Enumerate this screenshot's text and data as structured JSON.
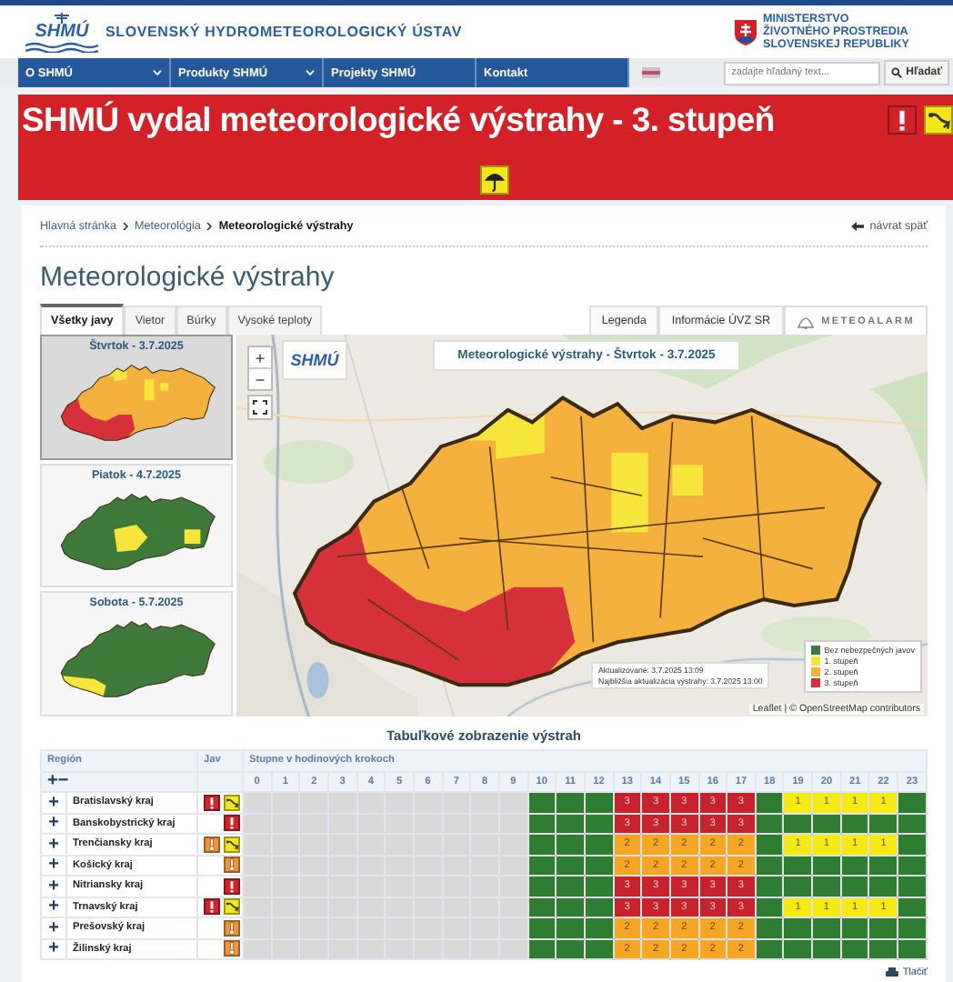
{
  "header": {
    "logo": "SHMÚ",
    "institute": "SLOVENSKÝ HYDROMETEOROLOGICKÝ ÚSTAV",
    "ministry": [
      "MINISTERSTVO",
      "ŽIVOTNÉHO PROSTREDIA",
      "SLOVENSKEJ REPUBLIKY"
    ]
  },
  "nav": {
    "items": [
      {
        "label": "O SHMÚ",
        "dropdown": true
      },
      {
        "label": "Produkty SHMÚ",
        "dropdown": true
      },
      {
        "label": "Projekty SHMÚ",
        "dropdown": false
      },
      {
        "label": "Kontakt",
        "dropdown": false
      }
    ],
    "search": {
      "placeholder": "zadajte hľadaný text..."
    },
    "search_button": "Hľadať"
  },
  "banner": {
    "title": "SHMÚ vydal meteorologické výstrahy - 3. stupeň",
    "icons": [
      {
        "kind": "exclamation",
        "color": "#d3232a"
      },
      {
        "kind": "wind",
        "color": "#f5e61a"
      }
    ],
    "second_row_icons": [
      {
        "kind": "umbrella",
        "color": "#f5e61a"
      }
    ]
  },
  "breadcrumb": [
    "Hlavná stránka",
    "Meteorológia",
    "Meteorologické výstrahy"
  ],
  "back_link": "návrat späť",
  "page_title": "Meteorologické výstrahy",
  "tabs": [
    {
      "label": "Všetky javy",
      "selected": true
    },
    {
      "label": "Vietor",
      "selected": false
    },
    {
      "label": "Búrky",
      "selected": false
    },
    {
      "label": "Vysoké teploty",
      "selected": false
    }
  ],
  "buttons": [
    "Legenda",
    "Informácie ÚVZ SR"
  ],
  "meteoalarm": "METEOALARM",
  "days": [
    {
      "label": "Štvrtok - 3.7.2025",
      "selected": true
    },
    {
      "label": "Piatok - 4.7.2025",
      "selected": false
    },
    {
      "label": "Sobota - 5.7.2025",
      "selected": false
    }
  ],
  "map": {
    "zoom_in": "+",
    "zoom_out": "−",
    "logo": "SHMÚ",
    "title": "Meteorologické výstrahy - Štvrtok - 3.7.2025",
    "legend": [
      {
        "label": "Bez nebezpečných javov",
        "color": "#3e7b3a"
      },
      {
        "label": "1. stupeň",
        "color": "#f6e53a"
      },
      {
        "label": "2. stupeň",
        "color": "#f4b13e"
      },
      {
        "label": "3. stupeň",
        "color": "#d6303a"
      }
    ],
    "updated": "Aktualizované: 3.7.2025 13:09",
    "next_update": "Najbližšia aktualizácia výstrahy: 3.7.2025 13:00",
    "attribution": "Leaflet | © OpenStreetMap contributors"
  },
  "table": {
    "title": "Tabuľkové zobrazenie výstrah",
    "region_header": "Región",
    "phenomenon_header": "Jav",
    "hours_header": "Stupne v hodinových krokoch",
    "expand_all": "+",
    "collapse_all": "−",
    "hours": [
      "0",
      "1",
      "2",
      "3",
      "4",
      "5",
      "6",
      "7",
      "8",
      "9",
      "10",
      "11",
      "12",
      "13",
      "14",
      "15",
      "16",
      "17",
      "18",
      "19",
      "20",
      "21",
      "22",
      "23"
    ],
    "rows": [
      {
        "toggle": "+",
        "region": "Bratislavský kraj",
        "phenomena": [
          {
            "kind": "exclamation",
            "color": "#d3232a"
          },
          {
            "kind": "wind",
            "color": "#f5e61a"
          }
        ],
        "cells": [
          {
            "kind": "none"
          },
          {
            "kind": "none"
          },
          {
            "kind": "none"
          },
          {
            "kind": "none"
          },
          {
            "kind": "none"
          },
          {
            "kind": "none"
          },
          {
            "kind": "none"
          },
          {
            "kind": "none"
          },
          {
            "kind": "none"
          },
          {
            "kind": "none"
          },
          {
            "kind": "clear"
          },
          {
            "kind": "clear"
          },
          {
            "kind": "clear"
          },
          {
            "kind": "warning",
            "grade": "3"
          },
          {
            "kind": "warning",
            "grade": "3"
          },
          {
            "kind": "warning",
            "grade": "3"
          },
          {
            "kind": "warning",
            "grade": "3"
          },
          {
            "kind": "warning",
            "grade": "3"
          },
          {
            "kind": "clear"
          },
          {
            "kind": "warning",
            "grade": "1"
          },
          {
            "kind": "warning",
            "grade": "1"
          },
          {
            "kind": "warning",
            "grade": "1"
          },
          {
            "kind": "warning",
            "grade": "1"
          },
          {
            "kind": "clear"
          }
        ]
      },
      {
        "toggle": "+",
        "region": "Banskobystrický kraj",
        "phenomena": [
          {
            "kind": "exclamation",
            "color": "#d3232a"
          }
        ],
        "cells": [
          {
            "kind": "none"
          },
          {
            "kind": "none"
          },
          {
            "kind": "none"
          },
          {
            "kind": "none"
          },
          {
            "kind": "none"
          },
          {
            "kind": "none"
          },
          {
            "kind": "none"
          },
          {
            "kind": "none"
          },
          {
            "kind": "none"
          },
          {
            "kind": "none"
          },
          {
            "kind": "clear"
          },
          {
            "kind": "clear"
          },
          {
            "kind": "clear"
          },
          {
            "kind": "warning",
            "grade": "3"
          },
          {
            "kind": "warning",
            "grade": "3"
          },
          {
            "kind": "warning",
            "grade": "3"
          },
          {
            "kind": "warning",
            "grade": "3"
          },
          {
            "kind": "warning",
            "grade": "3"
          },
          {
            "kind": "clear"
          },
          {
            "kind": "clear"
          },
          {
            "kind": "clear"
          },
          {
            "kind": "clear"
          },
          {
            "kind": "clear"
          },
          {
            "kind": "clear"
          }
        ]
      },
      {
        "toggle": "+",
        "region": "Trenčiansky kraj",
        "phenomena": [
          {
            "kind": "thermometer",
            "color": "#f0943a"
          },
          {
            "kind": "wind",
            "color": "#f5e61a"
          }
        ],
        "cells": [
          {
            "kind": "none"
          },
          {
            "kind": "none"
          },
          {
            "kind": "none"
          },
          {
            "kind": "none"
          },
          {
            "kind": "none"
          },
          {
            "kind": "none"
          },
          {
            "kind": "none"
          },
          {
            "kind": "none"
          },
          {
            "kind": "none"
          },
          {
            "kind": "none"
          },
          {
            "kind": "clear"
          },
          {
            "kind": "clear"
          },
          {
            "kind": "clear"
          },
          {
            "kind": "warning",
            "grade": "2"
          },
          {
            "kind": "warning",
            "grade": "2"
          },
          {
            "kind": "warning",
            "grade": "2"
          },
          {
            "kind": "warning",
            "grade": "2"
          },
          {
            "kind": "warning",
            "grade": "2"
          },
          {
            "kind": "clear"
          },
          {
            "kind": "warning",
            "grade": "1"
          },
          {
            "kind": "warning",
            "grade": "1"
          },
          {
            "kind": "warning",
            "grade": "1"
          },
          {
            "kind": "warning",
            "grade": "1"
          },
          {
            "kind": "clear"
          }
        ]
      },
      {
        "toggle": "+",
        "region": "Košický kraj",
        "phenomena": [
          {
            "kind": "thermometer",
            "color": "#f0943a"
          }
        ],
        "cells": [
          {
            "kind": "none"
          },
          {
            "kind": "none"
          },
          {
            "kind": "none"
          },
          {
            "kind": "none"
          },
          {
            "kind": "none"
          },
          {
            "kind": "none"
          },
          {
            "kind": "none"
          },
          {
            "kind": "none"
          },
          {
            "kind": "none"
          },
          {
            "kind": "none"
          },
          {
            "kind": "clear"
          },
          {
            "kind": "clear"
          },
          {
            "kind": "clear"
          },
          {
            "kind": "warning",
            "grade": "2"
          },
          {
            "kind": "warning",
            "grade": "2"
          },
          {
            "kind": "warning",
            "grade": "2"
          },
          {
            "kind": "warning",
            "grade": "2"
          },
          {
            "kind": "warning",
            "grade": "2"
          },
          {
            "kind": "clear"
          },
          {
            "kind": "clear"
          },
          {
            "kind": "clear"
          },
          {
            "kind": "clear"
          },
          {
            "kind": "clear"
          },
          {
            "kind": "clear"
          }
        ]
      },
      {
        "toggle": "+",
        "region": "Nitriansky kraj",
        "phenomena": [
          {
            "kind": "exclamation",
            "color": "#d3232a"
          }
        ],
        "cells": [
          {
            "kind": "none"
          },
          {
            "kind": "none"
          },
          {
            "kind": "none"
          },
          {
            "kind": "none"
          },
          {
            "kind": "none"
          },
          {
            "kind": "none"
          },
          {
            "kind": "none"
          },
          {
            "kind": "none"
          },
          {
            "kind": "none"
          },
          {
            "kind": "none"
          },
          {
            "kind": "clear"
          },
          {
            "kind": "clear"
          },
          {
            "kind": "clear"
          },
          {
            "kind": "warning",
            "grade": "3"
          },
          {
            "kind": "warning",
            "grade": "3"
          },
          {
            "kind": "warning",
            "grade": "3"
          },
          {
            "kind": "warning",
            "grade": "3"
          },
          {
            "kind": "warning",
            "grade": "3"
          },
          {
            "kind": "clear"
          },
          {
            "kind": "clear"
          },
          {
            "kind": "clear"
          },
          {
            "kind": "clear"
          },
          {
            "kind": "clear"
          },
          {
            "kind": "clear"
          }
        ]
      },
      {
        "toggle": "+",
        "region": "Trnavský kraj",
        "phenomena": [
          {
            "kind": "exclamation",
            "color": "#d3232a"
          },
          {
            "kind": "wind",
            "color": "#f5e61a"
          }
        ],
        "cells": [
          {
            "kind": "none"
          },
          {
            "kind": "none"
          },
          {
            "kind": "none"
          },
          {
            "kind": "none"
          },
          {
            "kind": "none"
          },
          {
            "kind": "none"
          },
          {
            "kind": "none"
          },
          {
            "kind": "none"
          },
          {
            "kind": "none"
          },
          {
            "kind": "none"
          },
          {
            "kind": "clear"
          },
          {
            "kind": "clear"
          },
          {
            "kind": "clear"
          },
          {
            "kind": "warning",
            "grade": "3"
          },
          {
            "kind": "warning",
            "grade": "3"
          },
          {
            "kind": "warning",
            "grade": "3"
          },
          {
            "kind": "warning",
            "grade": "3"
          },
          {
            "kind": "warning",
            "grade": "3"
          },
          {
            "kind": "clear"
          },
          {
            "kind": "warning",
            "grade": "1"
          },
          {
            "kind": "warning",
            "grade": "1"
          },
          {
            "kind": "warning",
            "grade": "1"
          },
          {
            "kind": "warning",
            "grade": "1"
          },
          {
            "kind": "clear"
          }
        ]
      },
      {
        "toggle": "+",
        "region": "Prešovský kraj",
        "phenomena": [
          {
            "kind": "thermometer",
            "color": "#f0943a"
          }
        ],
        "cells": [
          {
            "kind": "none"
          },
          {
            "kind": "none"
          },
          {
            "kind": "none"
          },
          {
            "kind": "none"
          },
          {
            "kind": "none"
          },
          {
            "kind": "none"
          },
          {
            "kind": "none"
          },
          {
            "kind": "none"
          },
          {
            "kind": "none"
          },
          {
            "kind": "none"
          },
          {
            "kind": "clear"
          },
          {
            "kind": "clear"
          },
          {
            "kind": "clear"
          },
          {
            "kind": "warning",
            "grade": "2"
          },
          {
            "kind": "warning",
            "grade": "2"
          },
          {
            "kind": "warning",
            "grade": "2"
          },
          {
            "kind": "warning",
            "grade": "2"
          },
          {
            "kind": "warning",
            "grade": "2"
          },
          {
            "kind": "clear"
          },
          {
            "kind": "clear"
          },
          {
            "kind": "clear"
          },
          {
            "kind": "clear"
          },
          {
            "kind": "clear"
          },
          {
            "kind": "clear"
          }
        ]
      },
      {
        "toggle": "+",
        "region": "Žilinský kraj",
        "phenomena": [
          {
            "kind": "thermometer",
            "color": "#f0943a"
          }
        ],
        "cells": [
          {
            "kind": "none"
          },
          {
            "kind": "none"
          },
          {
            "kind": "none"
          },
          {
            "kind": "none"
          },
          {
            "kind": "none"
          },
          {
            "kind": "none"
          },
          {
            "kind": "none"
          },
          {
            "kind": "none"
          },
          {
            "kind": "none"
          },
          {
            "kind": "none"
          },
          {
            "kind": "clear"
          },
          {
            "kind": "clear"
          },
          {
            "kind": "clear"
          },
          {
            "kind": "warning",
            "grade": "2"
          },
          {
            "kind": "warning",
            "grade": "2"
          },
          {
            "kind": "warning",
            "grade": "2"
          },
          {
            "kind": "warning",
            "grade": "2"
          },
          {
            "kind": "warning",
            "grade": "2"
          },
          {
            "kind": "clear"
          },
          {
            "kind": "clear"
          },
          {
            "kind": "clear"
          },
          {
            "kind": "clear"
          },
          {
            "kind": "clear"
          },
          {
            "kind": "clear"
          }
        ]
      }
    ]
  },
  "print_link": "Tlačiť"
}
